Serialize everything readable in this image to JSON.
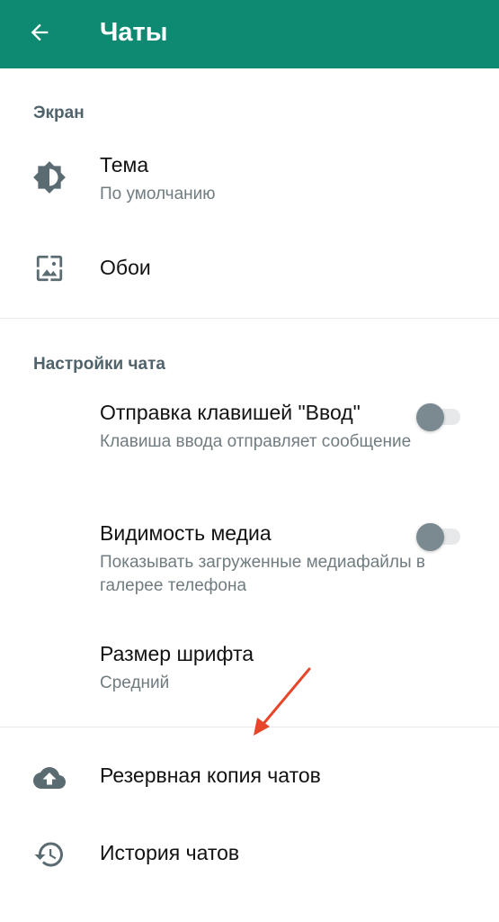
{
  "appbar": {
    "title": "Чаты",
    "back_icon": "arrow-left-icon",
    "background": "#0f8a72"
  },
  "display_section": {
    "header": "Экран",
    "items": [
      {
        "icon": "theme-brightness-icon",
        "label": "Тема",
        "value": "По умолчанию"
      },
      {
        "icon": "wallpaper-icon",
        "label": "Обои"
      }
    ]
  },
  "chat_settings_section": {
    "header": "Настройки чата",
    "items": [
      {
        "label": "Отправка клавишей \"Ввод\"",
        "description": "Клавиша ввода отправляет сообщение",
        "toggle_on": false
      },
      {
        "label": "Видимость медиа",
        "description": "Показывать загруженные медиафайлы в галерее телефона",
        "toggle_on": false
      },
      {
        "label": "Размер шрифта",
        "value": "Средний"
      }
    ]
  },
  "other_items": [
    {
      "icon": "cloud-upload-icon",
      "label": "Резервная копия чатов"
    },
    {
      "icon": "history-icon",
      "label": "История чатов"
    }
  ],
  "annotation": {
    "color": "#e8462a",
    "points_to": "Резервная копия чатов"
  }
}
